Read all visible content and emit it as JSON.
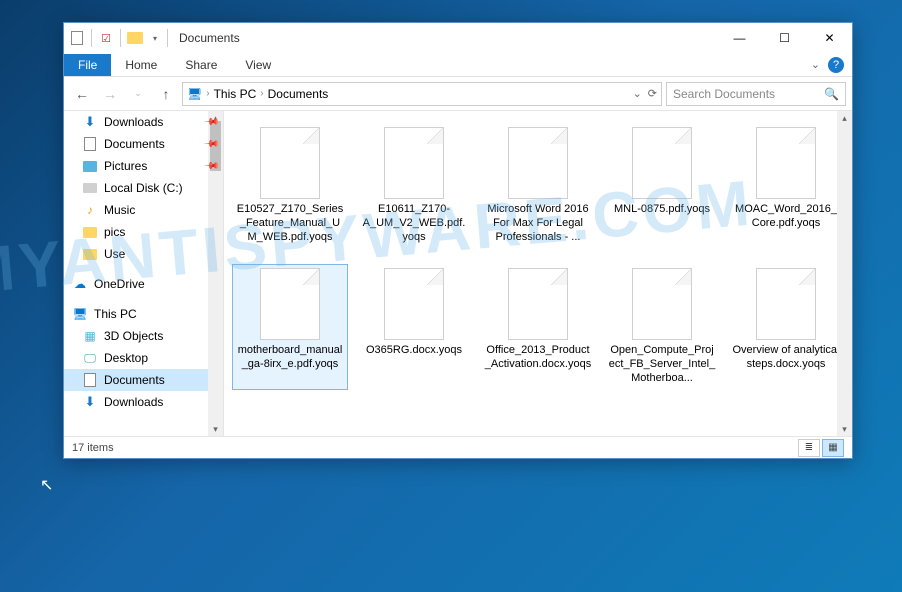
{
  "window_title": "Documents",
  "ribbon": {
    "file": "File",
    "home": "Home",
    "share": "Share",
    "view": "View"
  },
  "breadcrumb": {
    "root": "This PC",
    "current": "Documents"
  },
  "search_placeholder": "Search Documents",
  "nav_pane": [
    {
      "label": "Downloads",
      "icon": "dl",
      "pinned": true
    },
    {
      "label": "Documents",
      "icon": "doc",
      "pinned": true
    },
    {
      "label": "Pictures",
      "icon": "pic",
      "pinned": true
    },
    {
      "label": "Local Disk (C:)",
      "icon": "disk"
    },
    {
      "label": "Music",
      "icon": "music"
    },
    {
      "label": "pics",
      "icon": "folder"
    },
    {
      "label": "Use",
      "icon": "folder"
    },
    {
      "label": "OneDrive",
      "icon": "cloud",
      "root": true
    },
    {
      "label": "This PC",
      "icon": "pc",
      "root": true
    },
    {
      "label": "3D Objects",
      "icon": "3d"
    },
    {
      "label": "Desktop",
      "icon": "desktop"
    },
    {
      "label": "Documents",
      "icon": "doc",
      "selected": true
    },
    {
      "label": "Downloads",
      "icon": "dl"
    }
  ],
  "files": [
    {
      "name": "E10527_Z170_Series_Feature_Manual_UM_WEB.pdf.yoqs"
    },
    {
      "name": "E10611_Z170-A_UM_V2_WEB.pdf.yoqs"
    },
    {
      "name": "Microsoft Word 2016 For Max For Legal Professionals - ..."
    },
    {
      "name": "MNL-0875.pdf.yoqs"
    },
    {
      "name": "MOAC_Word_2016_Core.pdf.yoqs"
    },
    {
      "name": "motherboard_manual_ga-8irx_e.pdf.yoqs",
      "selected": true
    },
    {
      "name": "O365RG.docx.yoqs"
    },
    {
      "name": "Office_2013_Product_Activation.docx.yoqs"
    },
    {
      "name": "Open_Compute_Project_FB_Server_Intel_Motherboa..."
    },
    {
      "name": "Overview of analytical steps.docx.yoqs"
    }
  ],
  "status": {
    "count": "17 items"
  }
}
